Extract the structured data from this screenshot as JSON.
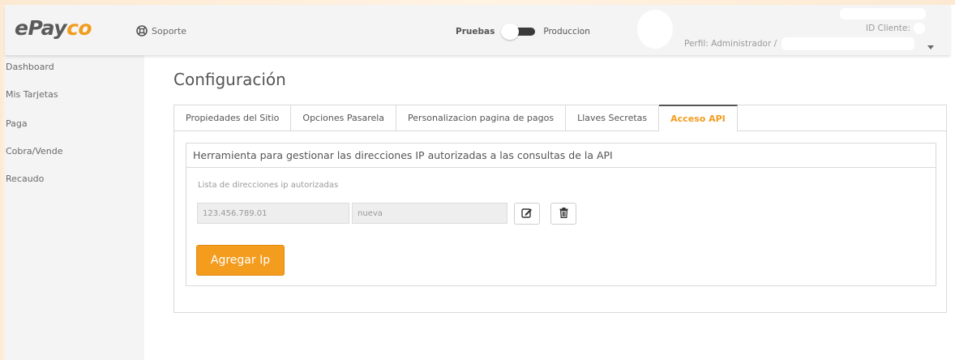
{
  "header": {
    "logo": {
      "e": "ePay",
      "co": "co"
    },
    "support_label": "Soporte",
    "env_left": "Pruebas",
    "env_right": "Produccion",
    "perfil_label": "Perfil: Administrador /",
    "id_cliente_label": "ID Cliente:"
  },
  "sidebar": {
    "items": [
      {
        "label": "Dashboard"
      },
      {
        "label": "Mis Tarjetas"
      },
      {
        "label": "Paga"
      },
      {
        "label": "Cobra/Vende"
      },
      {
        "label": "Recaudo"
      }
    ]
  },
  "page": {
    "title": "Configuración",
    "tabs": [
      {
        "label": "Propiedades del Sitio"
      },
      {
        "label": "Opciones Pasarela"
      },
      {
        "label": "Personalizacion pagina de pagos"
      },
      {
        "label": "Llaves Secretas"
      },
      {
        "label": "Acceso API"
      }
    ],
    "active_tab": "Acceso API",
    "panel_heading": "Herramienta para gestionar las direcciones IP autorizadas a las consultas de la API",
    "list_label": "Lista de direcciones ip autorizadas",
    "ip_value": "123.456.789.01",
    "name_value": "nueva",
    "add_button": "Agregar Ip"
  },
  "colors": {
    "accent": "#f39c1e",
    "text": "#555555",
    "muted": "#9a9a9a",
    "header_bg": "#f4f4f4"
  },
  "icons": [
    "support-lifebuoy-icon",
    "edit-icon",
    "trash-icon",
    "chevron-down-icon"
  ]
}
